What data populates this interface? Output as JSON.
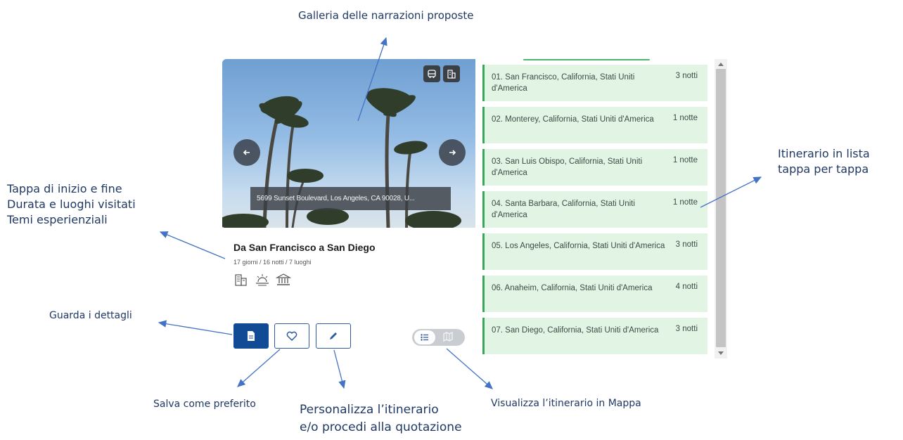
{
  "annotations": {
    "gallery": "Galleria delle narrazioni proposte",
    "tappa_lines": [
      "Tappa di inizio e fine",
      "Durata e luoghi visitati",
      "Temi esperienziali"
    ],
    "itinerario_lines": [
      "Itinerario in lista",
      "tappa per tappa"
    ],
    "dettagli": "Guarda i dettagli",
    "salva": "Salva come preferito",
    "personalizza_lines": [
      "Personalizza l’itinerario",
      "e/o procedi alla quotazione"
    ],
    "mappa": "Visualizza l’itinerario in Mappa"
  },
  "card": {
    "photo_caption": "5699 Sunset Boulevard, Los Angeles, CA 90028, U...",
    "title": "Da San Francisco a San Diego",
    "meta": "17 giorni / 16 notti / 7 luoghi",
    "top_icons": [
      "bus-icon",
      "building-icon"
    ],
    "theme_icons": [
      "city-icon",
      "beach-icon",
      "museum-icon"
    ],
    "buttons": [
      "document-icon",
      "heart-icon",
      "pencil-icon"
    ],
    "view_toggle": {
      "selected": "list",
      "options": [
        "list-icon",
        "map-icon"
      ]
    }
  },
  "itinerary": [
    {
      "name": "01. San Francisco, California, Stati Uniti d'America",
      "nights": "3 notti"
    },
    {
      "name": "02. Monterey, California, Stati Uniti d'America",
      "nights": "1 notte"
    },
    {
      "name": "03. San Luis Obispo, California, Stati Uniti d'America",
      "nights": "1 notte"
    },
    {
      "name": "04. Santa Barbara, California, Stati Uniti d'America",
      "nights": "1 notte"
    },
    {
      "name": "05. Los Angeles, California, Stati Uniti d'America",
      "nights": "3 notti"
    },
    {
      "name": "06. Anaheim, California, Stati Uniti d'America",
      "nights": "4 notti"
    },
    {
      "name": "07. San Diego, California, Stati Uniti d'America",
      "nights": "3 notti"
    }
  ],
  "colors": {
    "annotation_text": "#1f3864",
    "arrow": "#4472c4",
    "primary_button": "#114b95",
    "stage_background": "#e2f5e5",
    "stage_border": "#3aa65a"
  }
}
